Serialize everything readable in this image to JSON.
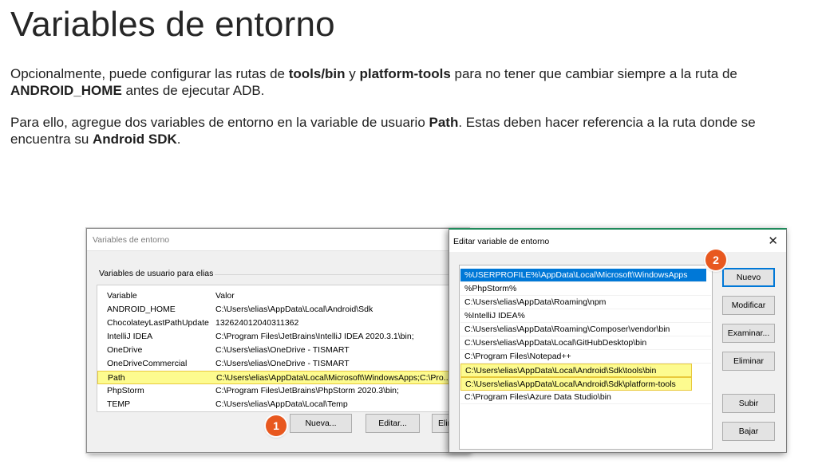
{
  "page": {
    "title": "Variables de entorno",
    "paragraphs": [
      [
        {
          "t": "Opcionalmente, puede configurar las rutas de ",
          "b": false
        },
        {
          "t": "tools/bin",
          "b": true
        },
        {
          "t": " y ",
          "b": false
        },
        {
          "t": "platform-tools",
          "b": true
        },
        {
          "t": " para no tener que cambiar siempre a la ruta de ",
          "b": false
        },
        {
          "t": "ANDROID_HOME",
          "b": true
        },
        {
          "t": " antes de ejecutar ADB.",
          "b": false
        }
      ],
      [
        {
          "t": "Para ello, agregue dos variables de entorno en la variable de usuario ",
          "b": false
        },
        {
          "t": "Path",
          "b": true
        },
        {
          "t": ". Estas deben hacer referencia a la ruta donde se encuentra su ",
          "b": false
        },
        {
          "t": "Android SDK",
          "b": true
        },
        {
          "t": ".",
          "b": false
        }
      ]
    ]
  },
  "env_window": {
    "title": "Variables de entorno",
    "group_label": "Variables de usuario para elias",
    "columns": [
      "Variable",
      "Valor"
    ],
    "rows": [
      {
        "name": "ANDROID_HOME",
        "value": "C:\\Users\\elias\\AppData\\Local\\Android\\Sdk",
        "highlight": false
      },
      {
        "name": "ChocolateyLastPathUpdate",
        "value": "132624012040311362",
        "highlight": false
      },
      {
        "name": "IntelliJ IDEA",
        "value": "C:\\Program Files\\JetBrains\\IntelliJ IDEA 2020.3.1\\bin;",
        "highlight": false
      },
      {
        "name": "OneDrive",
        "value": "C:\\Users\\elias\\OneDrive - TISMART",
        "highlight": false
      },
      {
        "name": "OneDriveCommercial",
        "value": "C:\\Users\\elias\\OneDrive - TISMART",
        "highlight": false
      },
      {
        "name": "Path",
        "value": "C:\\Users\\elias\\AppData\\Local\\Microsoft\\WindowsApps;C:\\Pro...",
        "highlight": true
      },
      {
        "name": "PhpStorm",
        "value": "C:\\Program Files\\JetBrains\\PhpStorm 2020.3\\bin;",
        "highlight": false
      },
      {
        "name": "TEMP",
        "value": "C:\\Users\\elias\\AppData\\Local\\Temp",
        "highlight": false
      }
    ],
    "buttons": {
      "new": "Nueva...",
      "edit": "Editar...",
      "delete": "Elimina"
    }
  },
  "edit_window": {
    "title": "Editar variable de entorno",
    "close_icon": "close-icon",
    "paths": [
      {
        "text": "%USERPROFILE%\\AppData\\Local\\Microsoft\\WindowsApps",
        "state": "selected"
      },
      {
        "text": "%PhpStorm%",
        "state": "normal"
      },
      {
        "text": "C:\\Users\\elias\\AppData\\Roaming\\npm",
        "state": "normal"
      },
      {
        "text": "%IntelliJ IDEA%",
        "state": "normal"
      },
      {
        "text": "C:\\Users\\elias\\AppData\\Roaming\\Composer\\vendor\\bin",
        "state": "normal"
      },
      {
        "text": "C:\\Users\\elias\\AppData\\Local\\GitHubDesktop\\bin",
        "state": "normal"
      },
      {
        "text": "C:\\Program Files\\Notepad++",
        "state": "normal"
      },
      {
        "text": "C:\\Users\\elias\\AppData\\Local\\Android\\Sdk\\tools\\bin",
        "state": "highlight"
      },
      {
        "text": "C:\\Users\\elias\\AppData\\Local\\Android\\Sdk\\platform-tools",
        "state": "highlight"
      },
      {
        "text": "C:\\Program Files\\Azure Data Studio\\bin",
        "state": "normal"
      }
    ],
    "buttons": {
      "new": "Nuevo",
      "edit": "Modificar",
      "browse": "Examinar...",
      "delete": "Eliminar",
      "up": "Subir",
      "down": "Bajar"
    }
  },
  "badges": {
    "one": "1",
    "two": "2"
  },
  "colors": {
    "highlight": "#fdfb8f",
    "selection": "#0078d7",
    "badge": "#e8581f",
    "dialog_accent": "#1f8a5b"
  }
}
